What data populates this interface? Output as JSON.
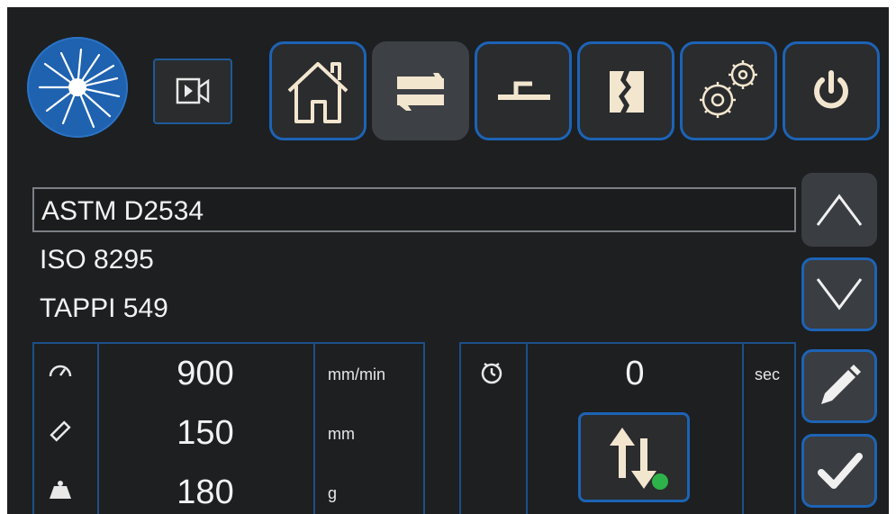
{
  "toolbar": {
    "buttons": [
      {
        "name": "home",
        "icon": "home-icon"
      },
      {
        "name": "swap",
        "icon": "swap-icon",
        "active": true
      },
      {
        "name": "hook",
        "icon": "hook-icon"
      },
      {
        "name": "sample",
        "icon": "sample-break-icon"
      },
      {
        "name": "settings",
        "icon": "gears-icon"
      },
      {
        "name": "power",
        "icon": "power-icon"
      }
    ]
  },
  "methods": {
    "items": [
      {
        "label": "ASTM D2534",
        "selected": true
      },
      {
        "label": "ISO 8295",
        "selected": false
      },
      {
        "label": "TAPPI 549",
        "selected": false
      }
    ]
  },
  "params": {
    "speed": {
      "value": "900",
      "unit": "mm/min",
      "icon": "speedometer-icon"
    },
    "distance": {
      "value": "150",
      "unit": "mm",
      "icon": "ruler-icon"
    },
    "weight": {
      "value": "180",
      "unit": "g",
      "icon": "weight-icon"
    }
  },
  "timer": {
    "value": "0",
    "unit": "sec",
    "icon": "stopwatch-icon"
  },
  "colors": {
    "accent": "#1d63b5",
    "background": "#1d1f21",
    "status_ok": "#2db34a"
  }
}
